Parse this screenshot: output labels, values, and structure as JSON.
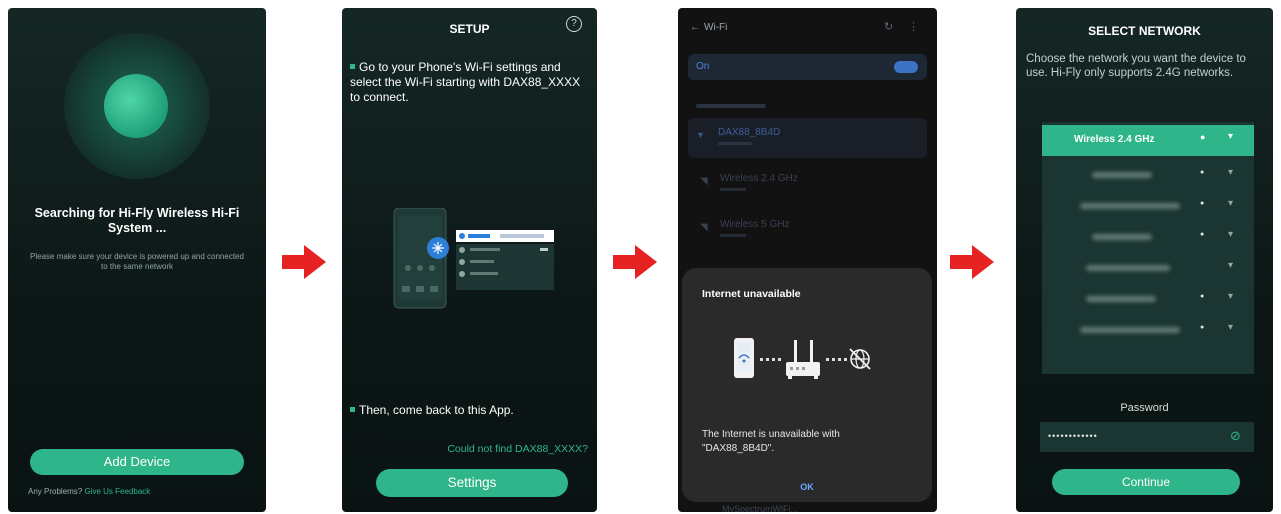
{
  "screen1": {
    "title": "Searching for Hi-Fly Wireless Hi-Fi System  ...",
    "subtitle": "Please make sure your device is powered up and connected to the same network",
    "add_device_label": "Add Device",
    "problems_label": "Any Problems?",
    "feedback_link": "Give Us Feedback"
  },
  "screen2": {
    "title": "SETUP",
    "help_icon": "?",
    "step1": "Go to your Phone's Wi-Fi settings and select the Wi-Fi starting with DAX88_XXXX to connect.",
    "step2": "Then, come back to this App.",
    "not_found_label": "Could not find  DAX88_XXXX?",
    "settings_label": "Settings"
  },
  "screen3": {
    "title": "Wi-Fi",
    "toggle_label": "On",
    "networks": [
      {
        "name": "DAX88_8B4D"
      },
      {
        "name": "Wireless 2.4 GHz"
      },
      {
        "name": "Wireless 5 GHz"
      }
    ],
    "dialog": {
      "title": "Internet unavailable",
      "message": "The Internet is unavailable with \"DAX88_8B4D\".",
      "ok_label": "OK"
    },
    "bottom_network": "MySpectrumWiFi..."
  },
  "screen4": {
    "title": "SELECT NETWORK",
    "description": "Choose the network you want the device to use. Hi-Fly only supports 2.4G networks.",
    "selected_network": "Wireless 2.4 GHz",
    "password_label": "Password",
    "password_value": "••••••••••••",
    "continue_label": "Continue"
  },
  "colors": {
    "accent": "#2fb58a",
    "arrow": "#e62222",
    "background_dark": "#0f1d1b"
  }
}
